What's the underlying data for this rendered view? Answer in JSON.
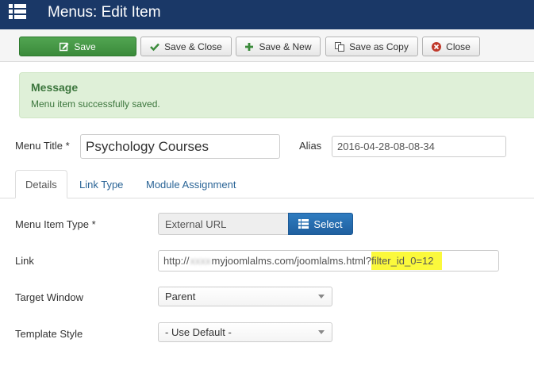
{
  "header": {
    "title": "Menus: Edit Item",
    "icon": "list-icon"
  },
  "toolbar": {
    "save_label": "Save",
    "save_close_label": "Save & Close",
    "save_new_label": "Save & New",
    "save_copy_label": "Save as Copy",
    "close_label": "Close"
  },
  "message": {
    "heading": "Message",
    "text": "Menu item successfully saved."
  },
  "form": {
    "menu_title_label": "Menu Title *",
    "menu_title_value": "Psychology Courses",
    "alias_label": "Alias",
    "alias_value": "2016-04-28-08-08-34"
  },
  "tabs": [
    {
      "label": "Details",
      "active": true
    },
    {
      "label": "Link Type",
      "active": false
    },
    {
      "label": "Module Assignment",
      "active": false
    }
  ],
  "details": {
    "item_type_label": "Menu Item Type *",
    "item_type_value": "External URL",
    "select_label": "Select",
    "link_label": "Link",
    "link_prefix": "http://",
    "link_blurred": "xxxx",
    "link_middle": "myjoomlalms.com/joomlalms.html?",
    "link_highlight": "filter_id_0=12",
    "target_label": "Target Window",
    "target_value": "Parent",
    "template_label": "Template Style",
    "template_value": "- Use Default -"
  },
  "colors": {
    "header_bg": "#1a3867",
    "save_green": "#46a046",
    "select_blue": "#2a6eb0",
    "alert_bg": "#dff0d8",
    "highlight": "#fbf93c"
  }
}
